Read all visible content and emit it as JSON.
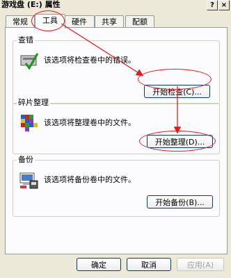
{
  "window": {
    "title": "游戏盘 (E:) 属性",
    "help_glyph": "?",
    "close_glyph": "×"
  },
  "tabs": [
    {
      "label": "常规"
    },
    {
      "label": "工具",
      "active": true
    },
    {
      "label": "硬件"
    },
    {
      "label": "共享"
    },
    {
      "label": "配额"
    }
  ],
  "check": {
    "title": "查错",
    "description": "该选项将检查卷中的错误。",
    "button": "开始检查(C)..."
  },
  "defrag": {
    "title": "碎片整理",
    "description": "该选项将整理卷中的文件。",
    "button": "开始整理(D)..."
  },
  "backup": {
    "title": "备份",
    "description": "该选项将备份卷中的文件。",
    "button": "开始备份(B)..."
  },
  "footer": {
    "ok": "确定",
    "cancel": "取消",
    "apply": "应用(A)"
  },
  "annotation_color": "#e21c1c"
}
